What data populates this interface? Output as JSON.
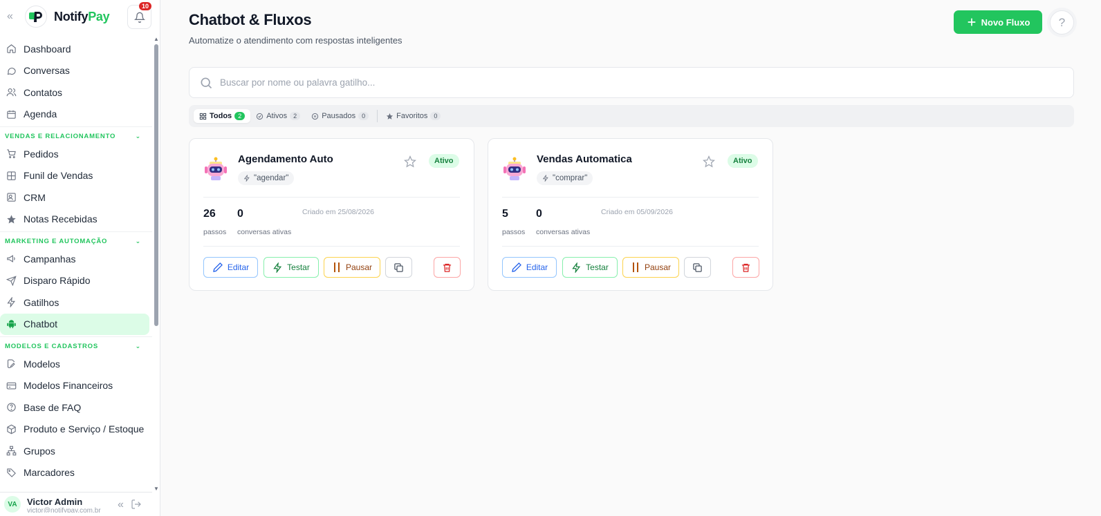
{
  "app": {
    "brand_first": "Notify",
    "brand_second": "Pay",
    "notification_count": "10"
  },
  "sidebar": {
    "main_items": [
      {
        "label": "Dashboard",
        "icon": "home-icon"
      },
      {
        "label": "Conversas",
        "icon": "chat-icon"
      },
      {
        "label": "Contatos",
        "icon": "users-icon"
      },
      {
        "label": "Agenda",
        "icon": "calendar-icon"
      }
    ],
    "sections": [
      {
        "title": "VENDAS E RELACIONAMENTO",
        "items": [
          {
            "label": "Pedidos",
            "icon": "cart-icon"
          },
          {
            "label": "Funil de Vendas",
            "icon": "board-icon"
          },
          {
            "label": "CRM",
            "icon": "contact-card-icon"
          },
          {
            "label": "Notas Recebidas",
            "icon": "star-icon"
          }
        ]
      },
      {
        "title": "MARKETING E AUTOMAÇÃO",
        "items": [
          {
            "label": "Campanhas",
            "icon": "megaphone-icon"
          },
          {
            "label": "Disparo Rápido",
            "icon": "send-icon"
          },
          {
            "label": "Gatilhos",
            "icon": "bolt-icon"
          },
          {
            "label": "Chatbot",
            "icon": "android-icon",
            "active": true
          }
        ]
      },
      {
        "title": "MODELOS E CADASTROS",
        "items": [
          {
            "label": "Modelos",
            "icon": "file-edit-icon"
          },
          {
            "label": "Modelos Financeiros",
            "icon": "credit-card-icon"
          },
          {
            "label": "Base de FAQ",
            "icon": "help-circle-icon"
          },
          {
            "label": "Produto e Serviço / Estoque",
            "icon": "box-icon"
          },
          {
            "label": "Grupos",
            "icon": "hierarchy-icon"
          },
          {
            "label": "Marcadores",
            "icon": "tag-icon"
          }
        ]
      }
    ],
    "user": {
      "initials": "VA",
      "name": "Victor Admin",
      "email": "victor@notifypay.com.br"
    }
  },
  "header": {
    "title": "Chatbot & Fluxos",
    "subtitle": "Automatize o atendimento com respostas inteligentes",
    "new_button": "Novo Fluxo"
  },
  "search": {
    "placeholder": "Buscar por nome ou palavra gatilho..."
  },
  "tabs": [
    {
      "label": "Todos",
      "count": "2",
      "icon": "grid-icon",
      "active": true
    },
    {
      "label": "Ativos",
      "count": "2",
      "icon": "check-circle-icon"
    },
    {
      "label": "Pausados",
      "count": "0",
      "icon": "pause-circle-icon"
    },
    {
      "label": "Favoritos",
      "count": "0",
      "icon": "star-icon"
    }
  ],
  "cards": [
    {
      "title": "Agendamento Auto",
      "trigger": "\"agendar\"",
      "status": "Ativo",
      "steps": "26",
      "steps_label": "passos",
      "active_conversations": "0",
      "active_conversations_label": "conversas ativas",
      "created": "Criado em 25/08/2026",
      "edit": "Editar",
      "test": "Testar",
      "pause": "Pausar"
    },
    {
      "title": "Vendas Automatica",
      "trigger": "\"comprar\"",
      "status": "Ativo",
      "steps": "5",
      "steps_label": "passos",
      "active_conversations": "0",
      "active_conversations_label": "conversas ativas",
      "created": "Criado em 05/09/2026",
      "edit": "Editar",
      "test": "Testar",
      "pause": "Pausar"
    }
  ],
  "colors": {
    "accent": "#22c55e",
    "active_bg": "#dcfce7",
    "badge_red": "#dc2626"
  }
}
